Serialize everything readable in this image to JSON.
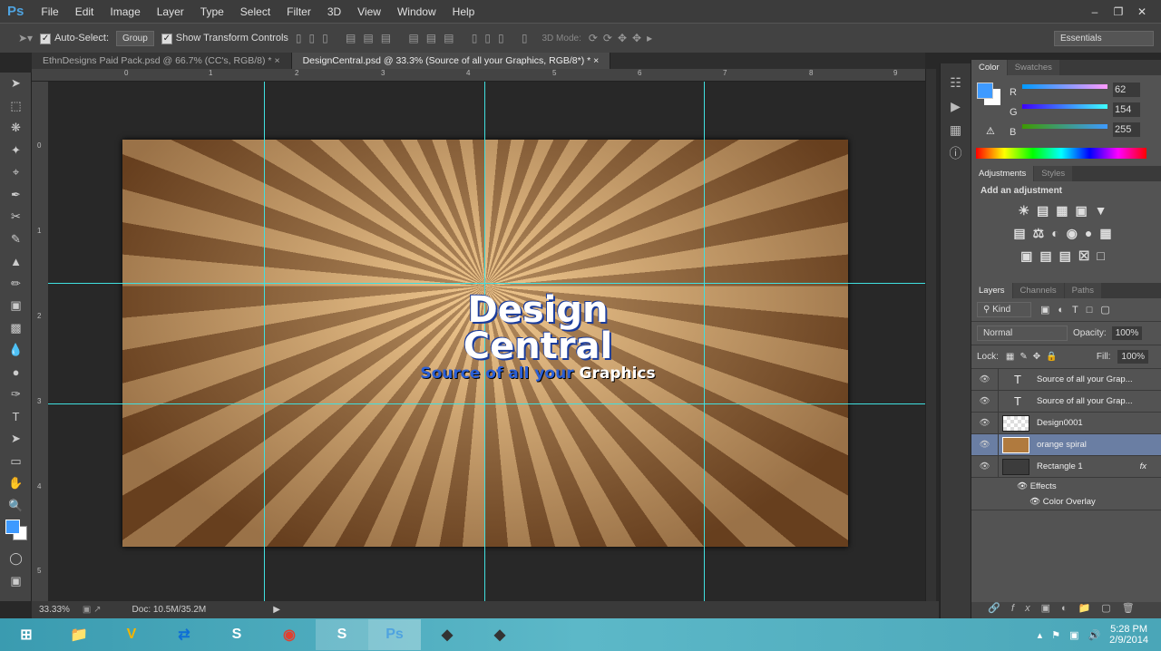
{
  "app": {
    "logo": "Ps",
    "menu": [
      "File",
      "Edit",
      "Image",
      "Layer",
      "Type",
      "Select",
      "Filter",
      "3D",
      "View",
      "Window",
      "Help"
    ]
  },
  "options": {
    "auto_select": "Auto-Select:",
    "auto_select_value": "Group",
    "show_transform": "Show Transform Controls",
    "mode_3d": "3D Mode:",
    "workspace": "Essentials"
  },
  "tabs": [
    {
      "label": "EthnDesigns Paid Pack.psd @ 66.7% (CC's, RGB/8) *"
    },
    {
      "label": "DesignCentral.psd @ 33.3% (Source of all your Graphics, RGB/8*) *"
    }
  ],
  "ruler": {
    "top": [
      "0",
      "1",
      "2",
      "3",
      "4",
      "5",
      "6",
      "7",
      "8",
      "9"
    ],
    "left": [
      "0",
      "1",
      "2",
      "3",
      "4",
      "5"
    ]
  },
  "canvas": {
    "line1": "Design",
    "line2": "Central",
    "line3a": "Source of all your",
    "line3b": "Graphics"
  },
  "status": {
    "zoom": "33.33%",
    "doc": "Doc: 10.5M/35.2M"
  },
  "color_panel": {
    "tabs": [
      "Color",
      "Swatches"
    ],
    "r_label": "R",
    "g_label": "G",
    "b_label": "B",
    "r": "62",
    "g": "154",
    "b": "255",
    "fg": "#3e9aff"
  },
  "adjustments": {
    "tabs": [
      "Adjustments",
      "Styles"
    ],
    "title": "Add an adjustment"
  },
  "layers_panel": {
    "tabs": [
      "Layers",
      "Channels",
      "Paths"
    ],
    "filter": "Kind",
    "blend": "Normal",
    "opacity_label": "Opacity:",
    "opacity": "100%",
    "lock_label": "Lock:",
    "fill_label": "Fill:",
    "fill": "100%",
    "layers": [
      {
        "name": "Source of all your Grap..."
      },
      {
        "name": "Source of all your Grap..."
      },
      {
        "name": "Design0001"
      },
      {
        "name": "orange spiral"
      },
      {
        "name": "Rectangle 1",
        "fx": "fx"
      }
    ],
    "effects": "Effects",
    "color_overlay": "Color Overlay"
  },
  "taskbar": {
    "time": "5:28 PM",
    "date": "2/9/2014"
  }
}
